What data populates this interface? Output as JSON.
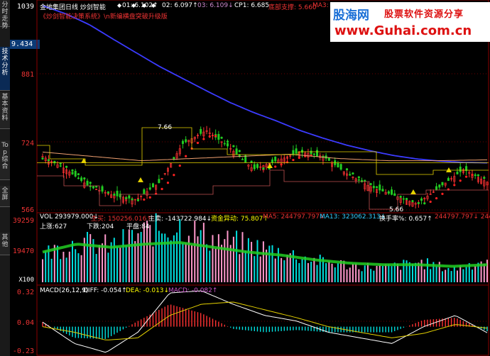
{
  "sidebar": {
    "tabs": [
      {
        "label": "分时走势",
        "active": false
      },
      {
        "label": "技术分析",
        "active": true
      },
      {
        "label": "基本资料",
        "active": false
      },
      {
        "label": "Top综合",
        "active": false
      },
      {
        "label": "全屏",
        "active": false
      },
      {
        "label": "其他",
        "active": false
      }
    ]
  },
  "price_axis": {
    "ticks": [
      "1039",
      "881",
      "724",
      "566"
    ],
    "current_price": "9.434"
  },
  "volume_axis": {
    "ticks": [
      "39259",
      "19470"
    ],
    "unit": "X100"
  },
  "macd_axis": {
    "ticks": [
      "0.32",
      "0.04",
      "-0.23"
    ]
  },
  "price_header": {
    "title": "金地集团日线 炒剑智能",
    "o1": "01: 6.102↑",
    "o2": "02: 6.097↑",
    "o3": "03: 6.109↓",
    "cp1": "CP1: 6.685",
    "support": "底部支撑: 5.660",
    "ma3": "MA3: 6..."
  },
  "subtitle": "《炒剑智能决策系统》\\n新编横盘突破升级版",
  "volume_header": {
    "vol": "VOL 293979.000↓",
    "main_buy": "主买: 150256.016↑",
    "main_sell": "主卖: -143722.984↓",
    "flow": "资金异动: 75.807↑",
    "ma5": "MA5: 244797.797↓",
    "ma13": "MA13: 323062.313↓",
    "turnover": "换手率%: 0.657↑",
    "extra": "244797.797↓ 24479",
    "up": "上涨:627",
    "down": "下跌:204",
    "flat": "平盘:84"
  },
  "macd_header": {
    "name": "MACD(26,12,9)",
    "diff": "DIFF: -0.054↑",
    "dea": "DEA: -0.013↓",
    "macd": "MACD: -0.082↑"
  },
  "annotations": {
    "high": "7.66",
    "low": "5.66"
  },
  "logo": {
    "brand": "股海网",
    "tagline": "股票软件资源分享",
    "url": "www.Guhai.com.cn"
  },
  "colors": {
    "up": "#ff3333",
    "down": "#00e0e0",
    "long_ma": "#3b3bff",
    "green_ma": "#22cc22",
    "red_ma": "#ff2222",
    "yellow": "#e6d200",
    "pink": "#ff99cc",
    "white": "#ffffff",
    "accent_blue": "#0b3a76"
  },
  "chart_data": {
    "type": "line",
    "panels": [
      "price",
      "volume",
      "macd"
    ],
    "price_ylim": [
      5.66,
      10.39
    ],
    "long_ma": [
      10.39,
      10.2,
      9.95,
      9.62,
      9.3,
      8.98,
      8.7,
      8.42,
      8.15,
      7.92,
      7.72,
      7.5,
      7.32,
      7.16,
      7.03,
      6.92,
      6.84,
      6.79,
      6.76,
      6.75
    ],
    "close": [
      6.9,
      6.6,
      6.2,
      6.0,
      5.9,
      6.3,
      7.2,
      7.5,
      7.1,
      6.6,
      6.8,
      7.0,
      6.9,
      6.5,
      6.2,
      6.0,
      5.8,
      6.2,
      6.6,
      6.3
    ],
    "volume": [
      19470,
      28000,
      25000,
      35000,
      39259,
      30000,
      26000,
      21000,
      15000,
      12000,
      10000,
      14000,
      9000,
      16000
    ],
    "macd_diff": [
      0.04,
      -0.15,
      -0.23,
      -0.05,
      0.3,
      0.32,
      0.2,
      0.1,
      0.05,
      -0.05,
      -0.1,
      -0.15,
      0.0,
      0.1,
      -0.054
    ],
    "macd_dea": [
      0.0,
      -0.05,
      -0.12,
      -0.1,
      0.1,
      0.2,
      0.22,
      0.15,
      0.08,
      0.0,
      -0.05,
      -0.1,
      -0.06,
      0.02,
      -0.013
    ]
  }
}
